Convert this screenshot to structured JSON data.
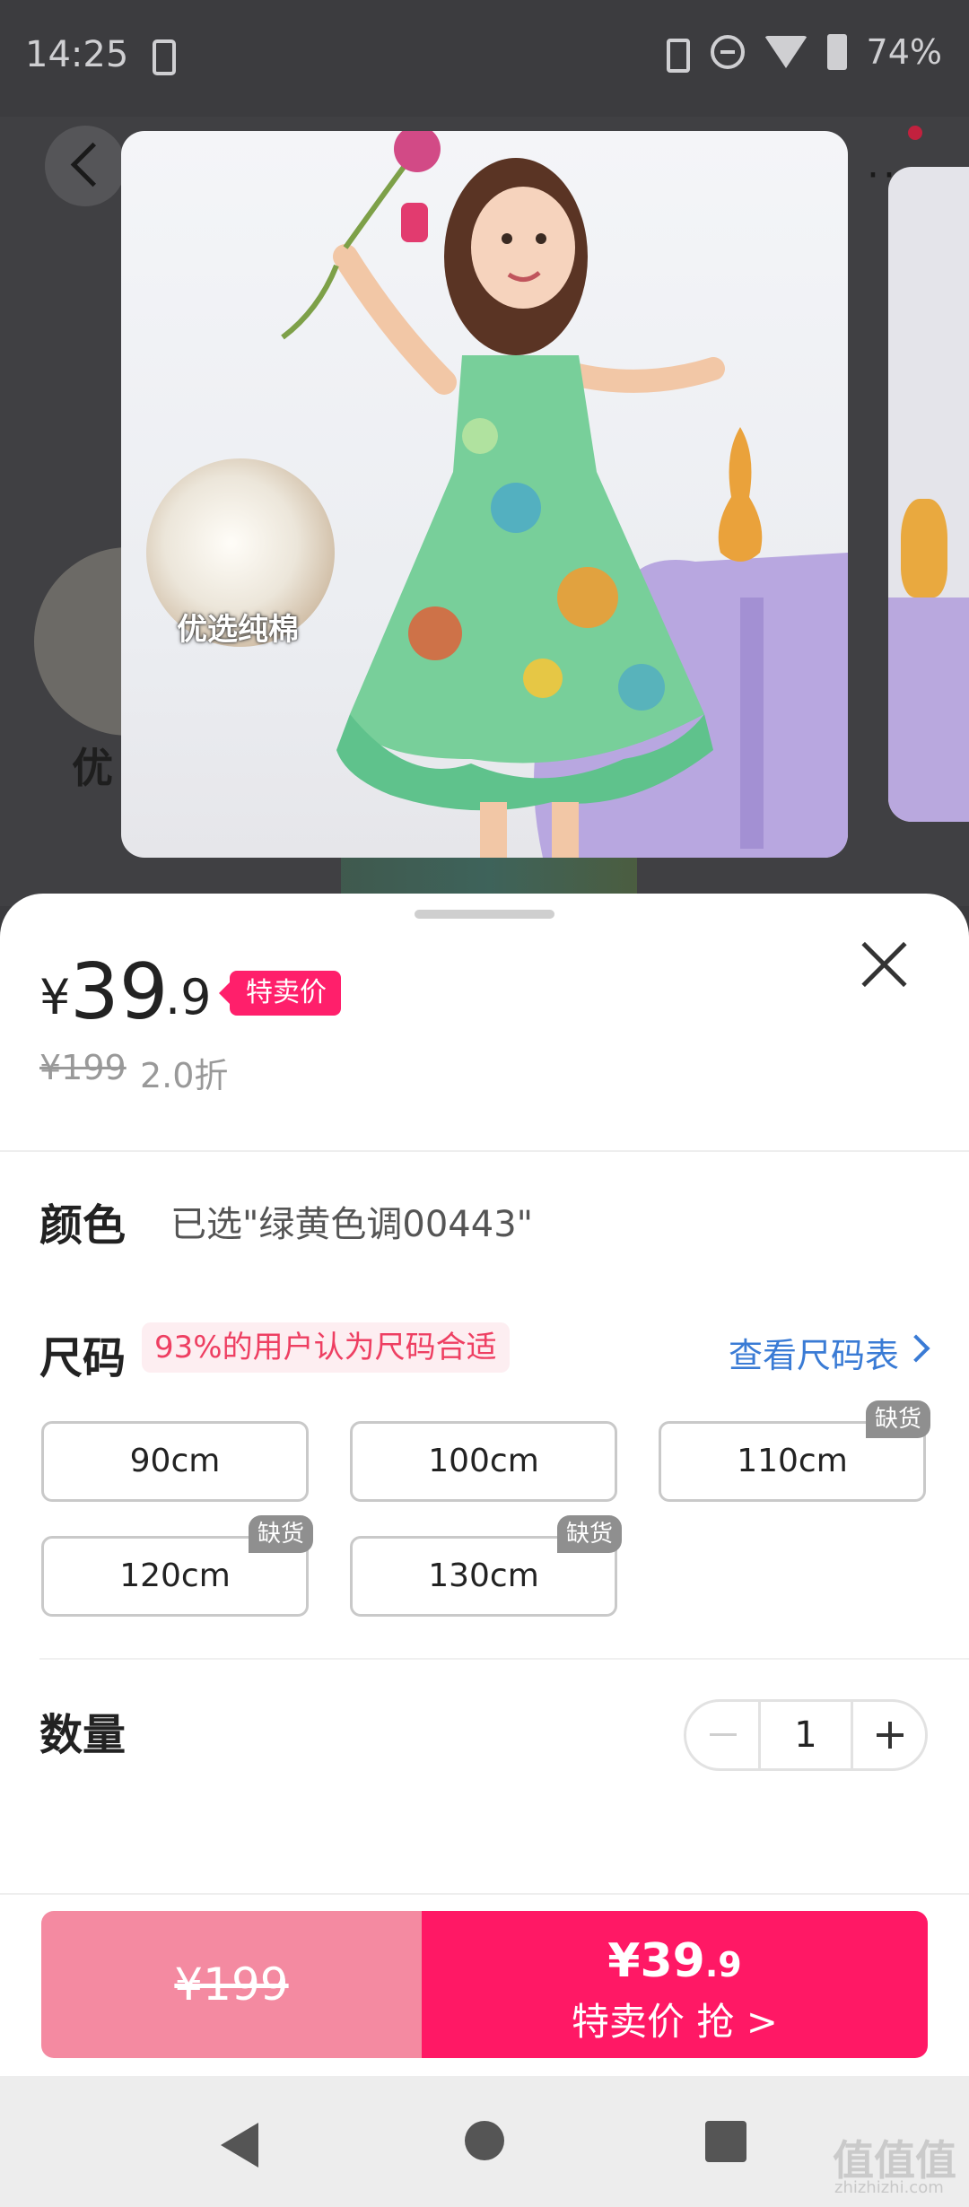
{
  "status_bar": {
    "time": "14:25",
    "battery": "74%"
  },
  "preview": {
    "badge_label": "优选纯棉"
  },
  "background_page": {
    "badge_label": "优"
  },
  "sheet": {
    "price": {
      "currency": "¥",
      "integer": "39",
      "decimal": ".9",
      "tag": "特卖价"
    },
    "original_price": "¥199",
    "discount": "2.0折",
    "color": {
      "title": "颜色",
      "selected": "已选\"绿黄色调00443\""
    },
    "size": {
      "title": "尺码",
      "fit_note": "93%的用户认为尺码合适",
      "chart_link": "查看尺码表",
      "options": [
        {
          "label": "90cm",
          "badge": ""
        },
        {
          "label": "100cm",
          "badge": ""
        },
        {
          "label": "110cm",
          "badge": "缺货"
        },
        {
          "label": "120cm",
          "badge": "缺货"
        },
        {
          "label": "130cm",
          "badge": "缺货"
        }
      ]
    },
    "quantity": {
      "title": "数量",
      "value": "1"
    },
    "buy_bar": {
      "original": "¥199",
      "price_int": "¥39",
      "price_dec": ".9",
      "label": "特卖价 抢 >"
    }
  },
  "watermark": {
    "main": "值值值",
    "sub": "zhizhizhi.com"
  },
  "colors": {
    "accent": "#ff1865",
    "tag": "#ff1f6b",
    "link": "#3a7bd5",
    "fit_note": "#ee3f62"
  }
}
